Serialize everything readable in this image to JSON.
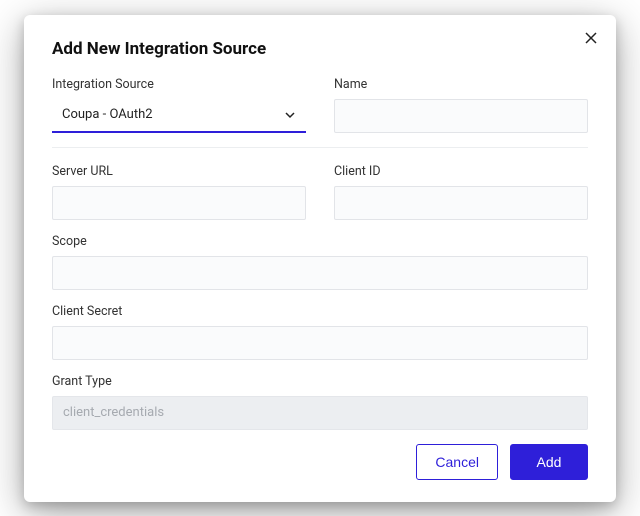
{
  "modal": {
    "title": "Add New Integration Source",
    "fields": {
      "integration_source": {
        "label": "Integration Source",
        "value": "Coupa - OAuth2"
      },
      "name": {
        "label": "Name",
        "value": ""
      },
      "server_url": {
        "label": "Server URL",
        "value": ""
      },
      "client_id": {
        "label": "Client ID",
        "value": ""
      },
      "scope": {
        "label": "Scope",
        "value": ""
      },
      "client_secret": {
        "label": "Client Secret",
        "value": ""
      },
      "grant_type": {
        "label": "Grant Type",
        "value": "client_credentials"
      }
    },
    "buttons": {
      "cancel": "Cancel",
      "add": "Add"
    }
  }
}
